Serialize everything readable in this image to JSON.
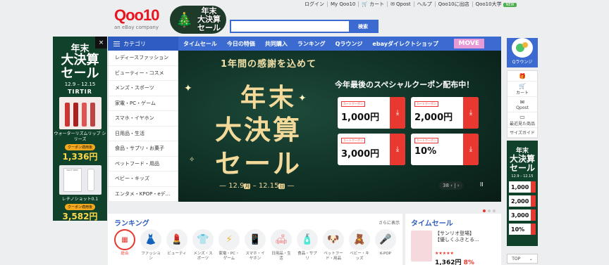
{
  "toplinks": [
    "ログイン",
    "My Qoo10",
    "カート",
    "Qpost",
    "ヘルプ",
    "Qoo10に出店",
    "Qoo10大学"
  ],
  "toplinks_badge": "NEW",
  "logo": {
    "text": "Qoo10",
    "sub": "an eBay company"
  },
  "promo_badge": {
    "line1": "年末",
    "line2": "大決算",
    "line3": "セール"
  },
  "search": {
    "placeholder": "",
    "button": "検索"
  },
  "nav": {
    "category": "カテゴリ",
    "items": [
      "タイムセール",
      "今日の特価",
      "共同購入",
      "ランキング",
      "Qラウンジ",
      "ebayダイレクトショップ"
    ],
    "move": "MOVE"
  },
  "categories": [
    "レディースファッション",
    "ビューティー・コスメ",
    "メンズ・スポーツ",
    "家電・PC・ゲーム",
    "スマホ・イヤホン",
    "日用品・生活",
    "食品・サプリ・お菓子",
    "ペットフード・用品",
    "ベビー・キッズ",
    "エンタメ・KPOP・eデ..."
  ],
  "left_ad": {
    "close": "×",
    "title1": "年末",
    "title2": "大決算",
    "title3": "セール",
    "dates": "12.9 – 12.15",
    "brand": "TIRTIR",
    "product1": "ウォーターリズムリップ シリーズ",
    "coupon1": "クーポン適用後",
    "price1": "1,336円",
    "product2_box": "TOUT VERT",
    "product2": "レチノショット0.1",
    "coupon2": "クーポン適用後",
    "price2": "3,582円"
  },
  "banner": {
    "arc_text": "1年間の感謝を込めて",
    "big1": "年末",
    "big2": "大決算",
    "big3": "セール",
    "date_start": "12.9",
    "date_start_day": "月",
    "date_end": "12.15",
    "date_end_day": "日",
    "headline": "今年最後のスペシャルクーポン配布中！",
    "coupon_tag": "カートクーポン",
    "coupons": [
      "1,000円",
      "2,000円",
      "3,000円",
      "10%"
    ],
    "counter": "38",
    "pause": "II"
  },
  "ranking": {
    "title": "ランキング",
    "more": "さらに表示",
    "items": [
      {
        "label": "総合",
        "icon": "all"
      },
      {
        "label": "ファッション",
        "icon": "dress"
      },
      {
        "label": "ビューティ",
        "icon": "lipstick"
      },
      {
        "label": "メンズ・スポーツ",
        "icon": "shirt"
      },
      {
        "label": "家電・PC・ゲーム",
        "icon": "dryer"
      },
      {
        "label": "スマホ・イヤホン",
        "icon": "phone"
      },
      {
        "label": "日用品・生活",
        "icon": "sofa"
      },
      {
        "label": "食品・サプリ",
        "icon": "bottle"
      },
      {
        "label": "ペットフード・用品",
        "icon": "dog"
      },
      {
        "label": "ベビー・キッズ",
        "icon": "baby"
      },
      {
        "label": "K-POP",
        "icon": "kpop"
      }
    ]
  },
  "timesale": {
    "title": "タイムセール",
    "desc1": "【サンリオ登場】",
    "desc2": "【優しくふきとる...",
    "stars": "★★★★★",
    "price": "1,362円",
    "pct": "8%"
  },
  "right_side": {
    "qlounge": "Qラウンジ",
    "items": [
      "カート",
      "Qpost",
      "最近見た商品",
      "サイズガイド"
    ],
    "ad_title1": "年末",
    "ad_title2": "大決算",
    "ad_title3": "セール",
    "ad_dates": "12.9 – 12.15",
    "ad_coupons": [
      "1,000",
      "2,000",
      "3,000",
      "10%"
    ],
    "top": "TOP"
  },
  "colors": {
    "brand_red": "#e8141e",
    "nav_blue": "#3b6ad1",
    "banner_green": "#0d2a20",
    "gold": "#f3d99a"
  }
}
